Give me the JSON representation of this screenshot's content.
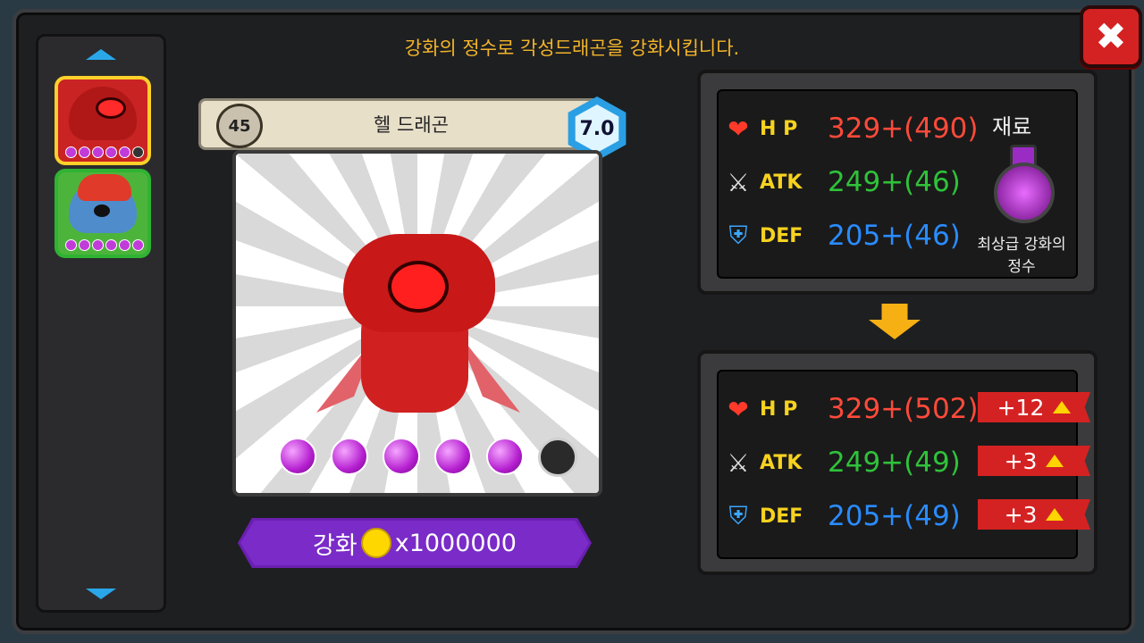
{
  "header": {
    "title": "강화의 정수로 각성드래곤을 강화시킵니다."
  },
  "pet": {
    "level": "45",
    "name": "헬 드래곤",
    "grade": "7.0"
  },
  "upgrade": {
    "label": "강화",
    "cost": "x1000000"
  },
  "current_stats": [
    {
      "label": "H P",
      "value": "329+(490)",
      "icon": "heart-icon"
    },
    {
      "label": "ATK",
      "value": "249+(46)",
      "icon": "sword-icon"
    },
    {
      "label": "DEF",
      "value": "205+(46)",
      "icon": "shield-icon"
    }
  ],
  "material": {
    "header": "재료",
    "name_line1": "최상급 강화의",
    "name_line2": "정수"
  },
  "next_stats": [
    {
      "label": "H P",
      "value": "329+(502)",
      "bonus": "+12"
    },
    {
      "label": "ATK",
      "value": "249+(49)",
      "bonus": "+3"
    },
    {
      "label": "DEF",
      "value": "205+(49)",
      "bonus": "+3"
    }
  ],
  "colors": {
    "accent_title": "#f3b52a",
    "hp": "#ff4a3a",
    "atk": "#2fc23a",
    "def": "#2a8cff",
    "upgrade_button": "#6a1fb0"
  },
  "gems": {
    "filled": 5,
    "total": 6
  }
}
